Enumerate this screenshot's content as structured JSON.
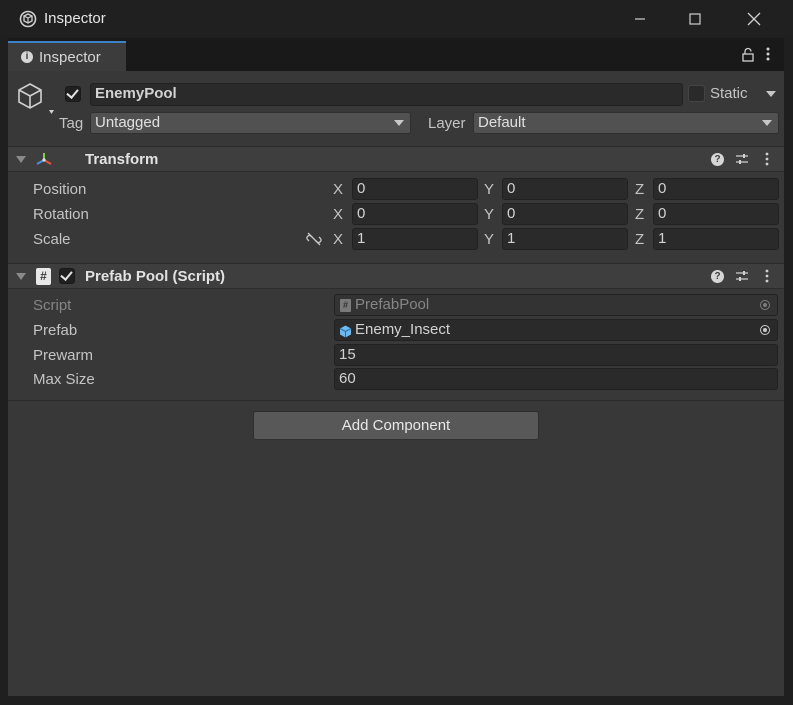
{
  "window": {
    "title": "Inspector"
  },
  "tab": {
    "label": "Inspector"
  },
  "gameobject": {
    "active": true,
    "name": "EnemyPool",
    "static_label": "Static",
    "static_checked": false,
    "tag_label": "Tag",
    "tag_value": "Untagged",
    "layer_label": "Layer",
    "layer_value": "Default"
  },
  "transform": {
    "title": "Transform",
    "rows": [
      {
        "label": "Position",
        "x": "0",
        "y": "0",
        "z": "0"
      },
      {
        "label": "Rotation",
        "x": "0",
        "y": "0",
        "z": "0"
      },
      {
        "label": "Scale",
        "x": "1",
        "y": "1",
        "z": "1"
      }
    ],
    "axes": {
      "x": "X",
      "y": "Y",
      "z": "Z"
    }
  },
  "prefab_pool": {
    "title": "Prefab Pool (Script)",
    "enabled": true,
    "script_label": "Script",
    "script_value": "PrefabPool",
    "prefab_label": "Prefab",
    "prefab_value": "Enemy_Insect",
    "prewarm_label": "Prewarm",
    "prewarm_value": "15",
    "maxsize_label": "Max Size",
    "maxsize_value": "60"
  },
  "add_component": {
    "label": "Add Component"
  },
  "colors": {
    "accent": "#3b82c9",
    "background": "#383838",
    "header": "#3e3e3e",
    "field": "#2a2a2a"
  }
}
